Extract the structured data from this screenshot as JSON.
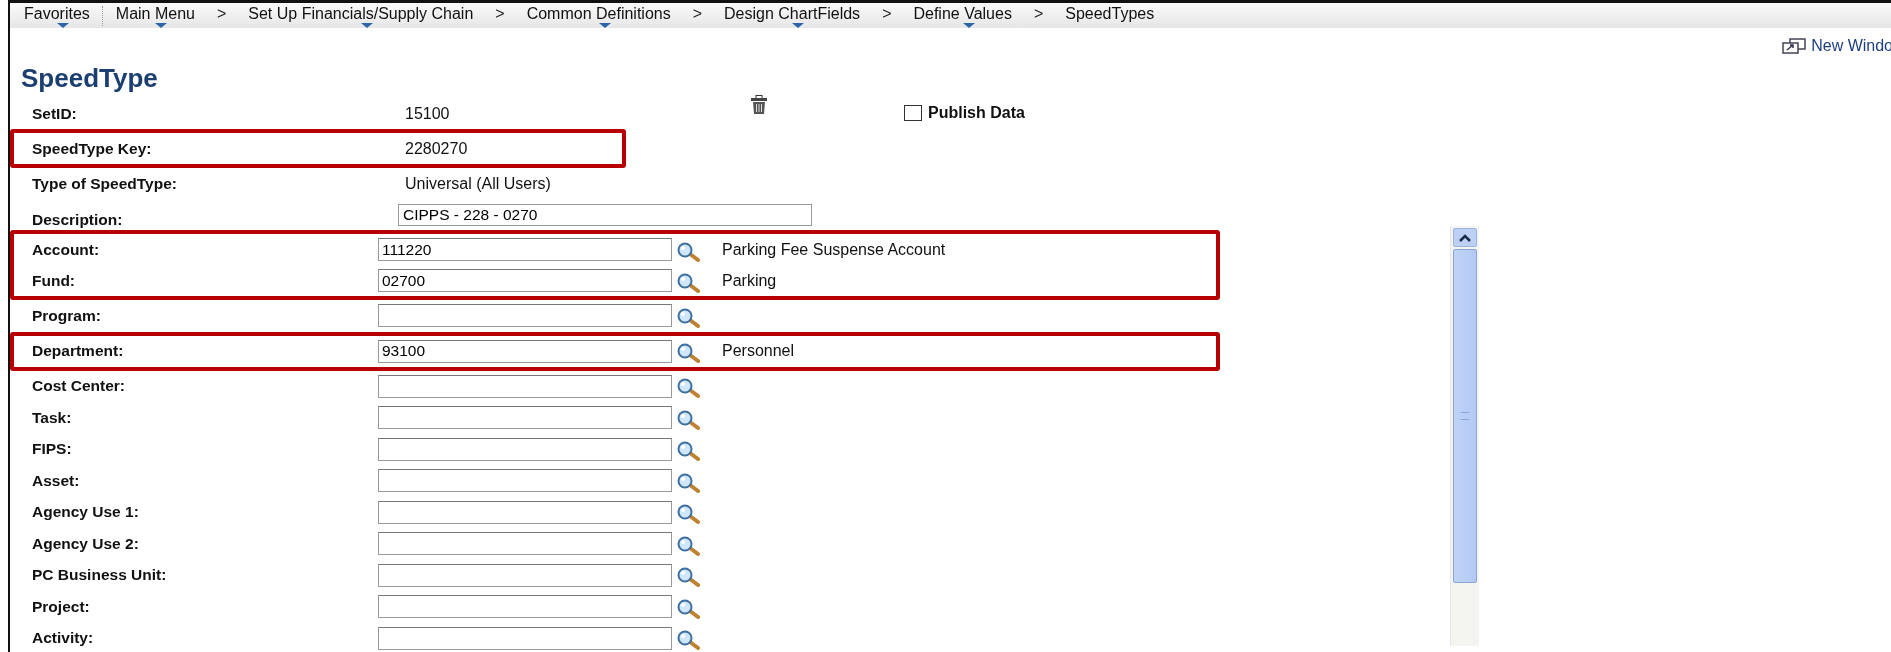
{
  "breadcrumbs": [
    {
      "label": "Favorites",
      "has_menu": true
    },
    {
      "label": "Main Menu",
      "has_menu": true
    },
    {
      "label": "Set Up Financials/Supply Chain",
      "prefix": ">",
      "has_menu": true
    },
    {
      "label": "Common Definitions",
      "prefix": ">",
      "has_menu": true
    },
    {
      "label": "Design ChartFields",
      "prefix": ">",
      "has_menu": true
    },
    {
      "label": "Define Values",
      "prefix": ">",
      "has_menu": true
    },
    {
      "label": "SpeedTypes",
      "prefix": ">",
      "has_menu": false
    }
  ],
  "new_window_link": "New Windo",
  "page_title": "SpeedType",
  "publish_data": {
    "label": "Publish Data",
    "checked": false
  },
  "groups": [
    {
      "highlighted": false,
      "rows": [
        {
          "kind": "display",
          "label": "SetID:",
          "value": "15100"
        }
      ]
    },
    {
      "highlighted": true,
      "rows": [
        {
          "kind": "display",
          "label": "SpeedType Key:",
          "value": "2280270"
        }
      ]
    },
    {
      "highlighted": false,
      "rows": [
        {
          "kind": "display",
          "label": "Type of SpeedType:",
          "value": "Universal (All Users)"
        },
        {
          "kind": "text",
          "label": "Description:",
          "value": "CIPPS - 228 - 0270"
        }
      ]
    },
    {
      "highlighted": true,
      "rows": [
        {
          "kind": "lookup",
          "label": "Account:",
          "value": "111220",
          "description": "Parking Fee Suspense Account"
        },
        {
          "kind": "lookup",
          "label": "Fund:",
          "value": "02700",
          "description": "Parking"
        }
      ]
    },
    {
      "highlighted": false,
      "rows": [
        {
          "kind": "lookup",
          "label": "Program:"
        }
      ]
    },
    {
      "highlighted": true,
      "rows": [
        {
          "kind": "lookup",
          "label": "Department:",
          "value": "93100",
          "description": "Personnel"
        }
      ]
    },
    {
      "highlighted": false,
      "rows": [
        {
          "kind": "lookup",
          "label": "Cost Center:"
        },
        {
          "kind": "lookup",
          "label": "Task:"
        },
        {
          "kind": "lookup",
          "label": "FIPS:"
        },
        {
          "kind": "lookup",
          "label": "Asset:"
        },
        {
          "kind": "lookup",
          "label": "Agency Use 1:"
        },
        {
          "kind": "lookup",
          "label": "Agency Use 2:"
        },
        {
          "kind": "lookup",
          "label": "PC Business Unit:"
        },
        {
          "kind": "lookup",
          "label": "Project:"
        },
        {
          "kind": "lookup",
          "label": "Activity:"
        }
      ]
    }
  ]
}
